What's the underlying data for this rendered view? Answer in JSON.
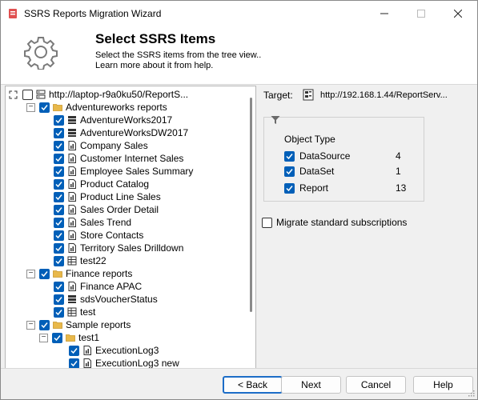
{
  "window": {
    "title": "SSRS Reports Migration Wizard"
  },
  "header": {
    "title": "Select SSRS Items",
    "subtitle_1": "Select the SSRS items from the tree view..",
    "subtitle_2": "Learn more about it from help."
  },
  "tree": {
    "root": "http://laptop-r9a0ku50/ReportS...",
    "folder_adventure": "Adventureworks reports",
    "adventure_items": [
      "AdventureWorks2017",
      "AdventureWorksDW2017",
      "Company Sales",
      "Customer Internet Sales",
      "Employee Sales Summary",
      "Product Catalog",
      "Product Line Sales",
      "Sales Order Detail",
      "Sales Trend",
      "Store Contacts",
      "Territory Sales Drilldown",
      "test22"
    ],
    "folder_finance": "Finance reports",
    "finance_items": [
      "Finance APAC",
      "sdsVoucherStatus",
      "test"
    ],
    "folder_sample": "Sample reports",
    "folder_test1": "test1",
    "test1_items": [
      "ExecutionLog3",
      "ExecutionLog3 new"
    ]
  },
  "target": {
    "label": "Target:",
    "url": "http://192.168.1.44/ReportServ..."
  },
  "object_type": {
    "title": "Object Type",
    "rows": [
      {
        "label": "DataSource",
        "count": "4"
      },
      {
        "label": "DataSet",
        "count": "1"
      },
      {
        "label": "Report",
        "count": "13"
      }
    ]
  },
  "migrate_label": "Migrate standard subscriptions",
  "buttons": {
    "back": "< Back",
    "next": "Next",
    "cancel": "Cancel",
    "help": "Help"
  },
  "colors": {
    "accent": "#005fb8",
    "folder": "#e8b84a"
  }
}
